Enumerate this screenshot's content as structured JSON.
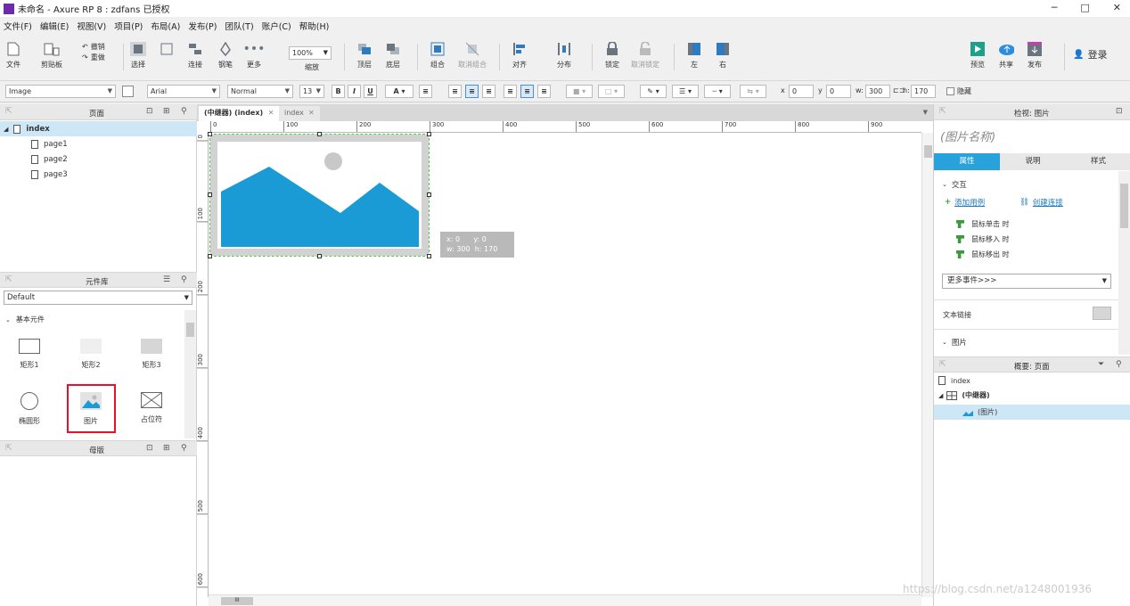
{
  "window": {
    "title": "未命名 - Axure RP 8 : zdfans 已授权",
    "min": "─",
    "max": "□",
    "close": "✕"
  },
  "menu": [
    "文件(F)",
    "编辑(E)",
    "视图(V)",
    "项目(P)",
    "布局(A)",
    "发布(P)",
    "团队(T)",
    "账户(C)",
    "帮助(H)"
  ],
  "toolbar": {
    "file": "文件",
    "clipboard": "剪贴板",
    "undo": "撤销",
    "redo": "重做",
    "select": "选择",
    "connect": "连接",
    "pen": "钢笔",
    "more": "更多",
    "zoom_value": "100%",
    "zoom": "缩放",
    "top": "顶层",
    "bottom": "底层",
    "group": "组合",
    "ungroup": "取消组合",
    "align": "对齐",
    "distribute": "分布",
    "lock": "锁定",
    "unlock": "取消锁定",
    "left": "左",
    "right": "右",
    "preview": "预览",
    "share": "共享",
    "publish": "发布",
    "login": "登录"
  },
  "format": {
    "widget_type": "Image",
    "font": "Arial",
    "style": "Normal",
    "size": "13",
    "bold": "B",
    "italic": "I",
    "underline": "U",
    "font_color": "A",
    "x_label": "x",
    "x": "0",
    "y_label": "y",
    "y": "0",
    "w_label": "w:",
    "w": "300",
    "h_label": "h:",
    "h": "170",
    "hide": "隐藏"
  },
  "pages_panel": {
    "title": "页面",
    "items": [
      "index",
      "page1",
      "page2",
      "page3"
    ]
  },
  "library_panel": {
    "title": "元件库",
    "selected_library": "Default",
    "section": "基本元件",
    "items": [
      "矩形1",
      "矩形2",
      "矩形3",
      "椭圆形",
      "图片",
      "占位符"
    ]
  },
  "masters_panel": {
    "title": "母版"
  },
  "canvas": {
    "tabs": [
      "(中继器) (index)",
      "index"
    ],
    "h_ticks": [
      "0",
      "100",
      "200",
      "300",
      "400",
      "500",
      "600",
      "700",
      "800",
      "900"
    ],
    "v_ticks": [
      "0",
      "100",
      "200",
      "300",
      "400",
      "500",
      "600"
    ],
    "tooltip": {
      "x": "x: 0",
      "y": "y: 0",
      "w": "w: 300",
      "h": "h: 170"
    }
  },
  "inspector": {
    "header": "检视: 图片",
    "name_placeholder": "(图片名称)",
    "tabs": [
      "属性",
      "说明",
      "样式"
    ],
    "interaction": "交互",
    "add_case": "添加用例",
    "create_link": "创建连接",
    "events": [
      "鼠标单击 时",
      "鼠标移入 时",
      "鼠标移出 时"
    ],
    "more_events": "更多事件>>>",
    "text_link": "文本链接",
    "image_section": "图片"
  },
  "outline": {
    "header": "概要: 页面",
    "root": "index",
    "repeater": "(中继器)",
    "image": "(图片)"
  },
  "watermark": "https://blog.csdn.net/a1248001936",
  "colors": {
    "accent": "#29a2dc",
    "image_blue": "#1a9bd6",
    "highlight": "#e8102a",
    "selection_green": "#59c759"
  }
}
